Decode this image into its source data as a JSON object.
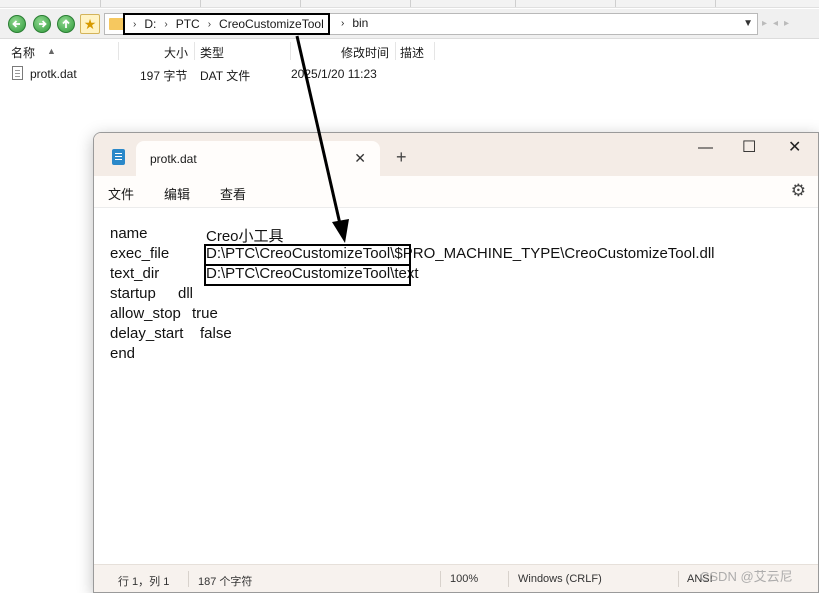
{
  "explorer": {
    "breadcrumb": [
      "D:",
      "PTC",
      "CreoCustomizeTool"
    ],
    "breadcrumb_last": "bin",
    "columns": {
      "name": "名称",
      "size": "大小",
      "type": "类型",
      "modified": "修改时间",
      "desc": "描述"
    },
    "files": [
      {
        "name": "protk.dat",
        "size": "197 字节",
        "type": "DAT 文件",
        "modified": "2025/1/20  11:23"
      }
    ]
  },
  "notepad": {
    "tab_title": "protk.dat",
    "menu": [
      "文件",
      "编辑",
      "查看"
    ],
    "lines": [
      {
        "key": "name",
        "value": "Creo小工具"
      },
      {
        "key": "exec_file",
        "value": "D:\\PTC\\CreoCustomizeTool\\$PRO_MACHINE_TYPE\\CreoCustomizeTool.dll"
      },
      {
        "key": "text_dir",
        "value": "D:\\PTC\\CreoCustomizeTool\\text"
      },
      {
        "key": "startup",
        "value": "dll"
      },
      {
        "key": "allow_stop",
        "value": "true"
      },
      {
        "key": "delay_start",
        "value": "false"
      },
      {
        "key": "end",
        "value": ""
      }
    ],
    "status": {
      "position": "行 1，列 1",
      "chars": "187 个字符",
      "zoom": "100%",
      "line_ending": "Windows (CRLF)",
      "encoding": "ANSI"
    }
  },
  "watermark": "CSDN @艾云尼"
}
